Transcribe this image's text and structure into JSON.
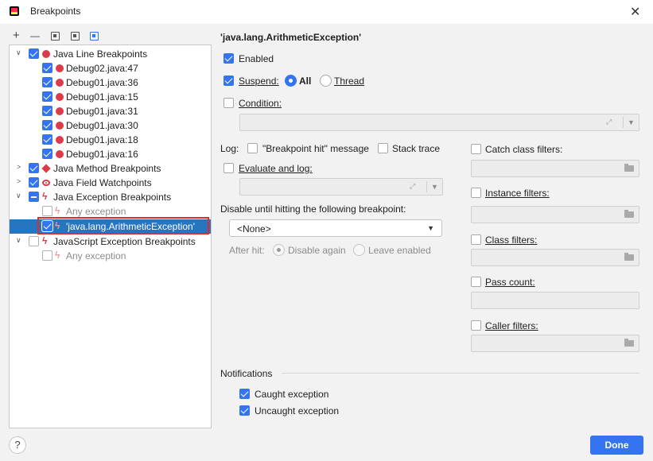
{
  "window": {
    "title": "Breakpoints",
    "close_glyph": "✕"
  },
  "toolbar": {
    "add": "+",
    "remove": "—"
  },
  "tree": {
    "java_line": {
      "label": "Java Line Breakpoints",
      "items": [
        "Debug02.java:47",
        "Debug01.java:36",
        "Debug01.java:15",
        "Debug01.java:31",
        "Debug01.java:30",
        "Debug01.java:18",
        "Debug01.java:16"
      ]
    },
    "java_method": "Java Method Breakpoints",
    "java_field": "Java Field Watchpoints",
    "java_exception": {
      "label": "Java Exception Breakpoints",
      "any": "Any exception",
      "selected": "'java.lang.ArithmeticException'"
    },
    "js_exception": {
      "label": "JavaScript Exception Breakpoints",
      "any": "Any exception"
    }
  },
  "detail": {
    "heading": "'java.lang.ArithmeticException'",
    "enabled": "Enabled",
    "suspend": "Suspend:",
    "all": "All",
    "thread": "Thread",
    "condition": "Condition:",
    "log": "Log:",
    "bp_hit": "\"Breakpoint hit\" message",
    "stack_trace": "Stack trace",
    "evaluate_log": "Evaluate and log:",
    "disable_until": "Disable until hitting the following breakpoint:",
    "none_option": "<None>",
    "after_hit": "After hit:",
    "disable_again": "Disable again",
    "leave_enabled": "Leave enabled"
  },
  "filters": {
    "catch": "Catch class filters:",
    "instance": "Instance filters:",
    "class": "Class filters:",
    "pass_count": "Pass count:",
    "caller": "Caller filters:"
  },
  "notifications": {
    "title": "Notifications",
    "caught": "Caught exception",
    "uncaught": "Uncaught exception"
  },
  "footer": {
    "help": "?",
    "done": "Done"
  }
}
